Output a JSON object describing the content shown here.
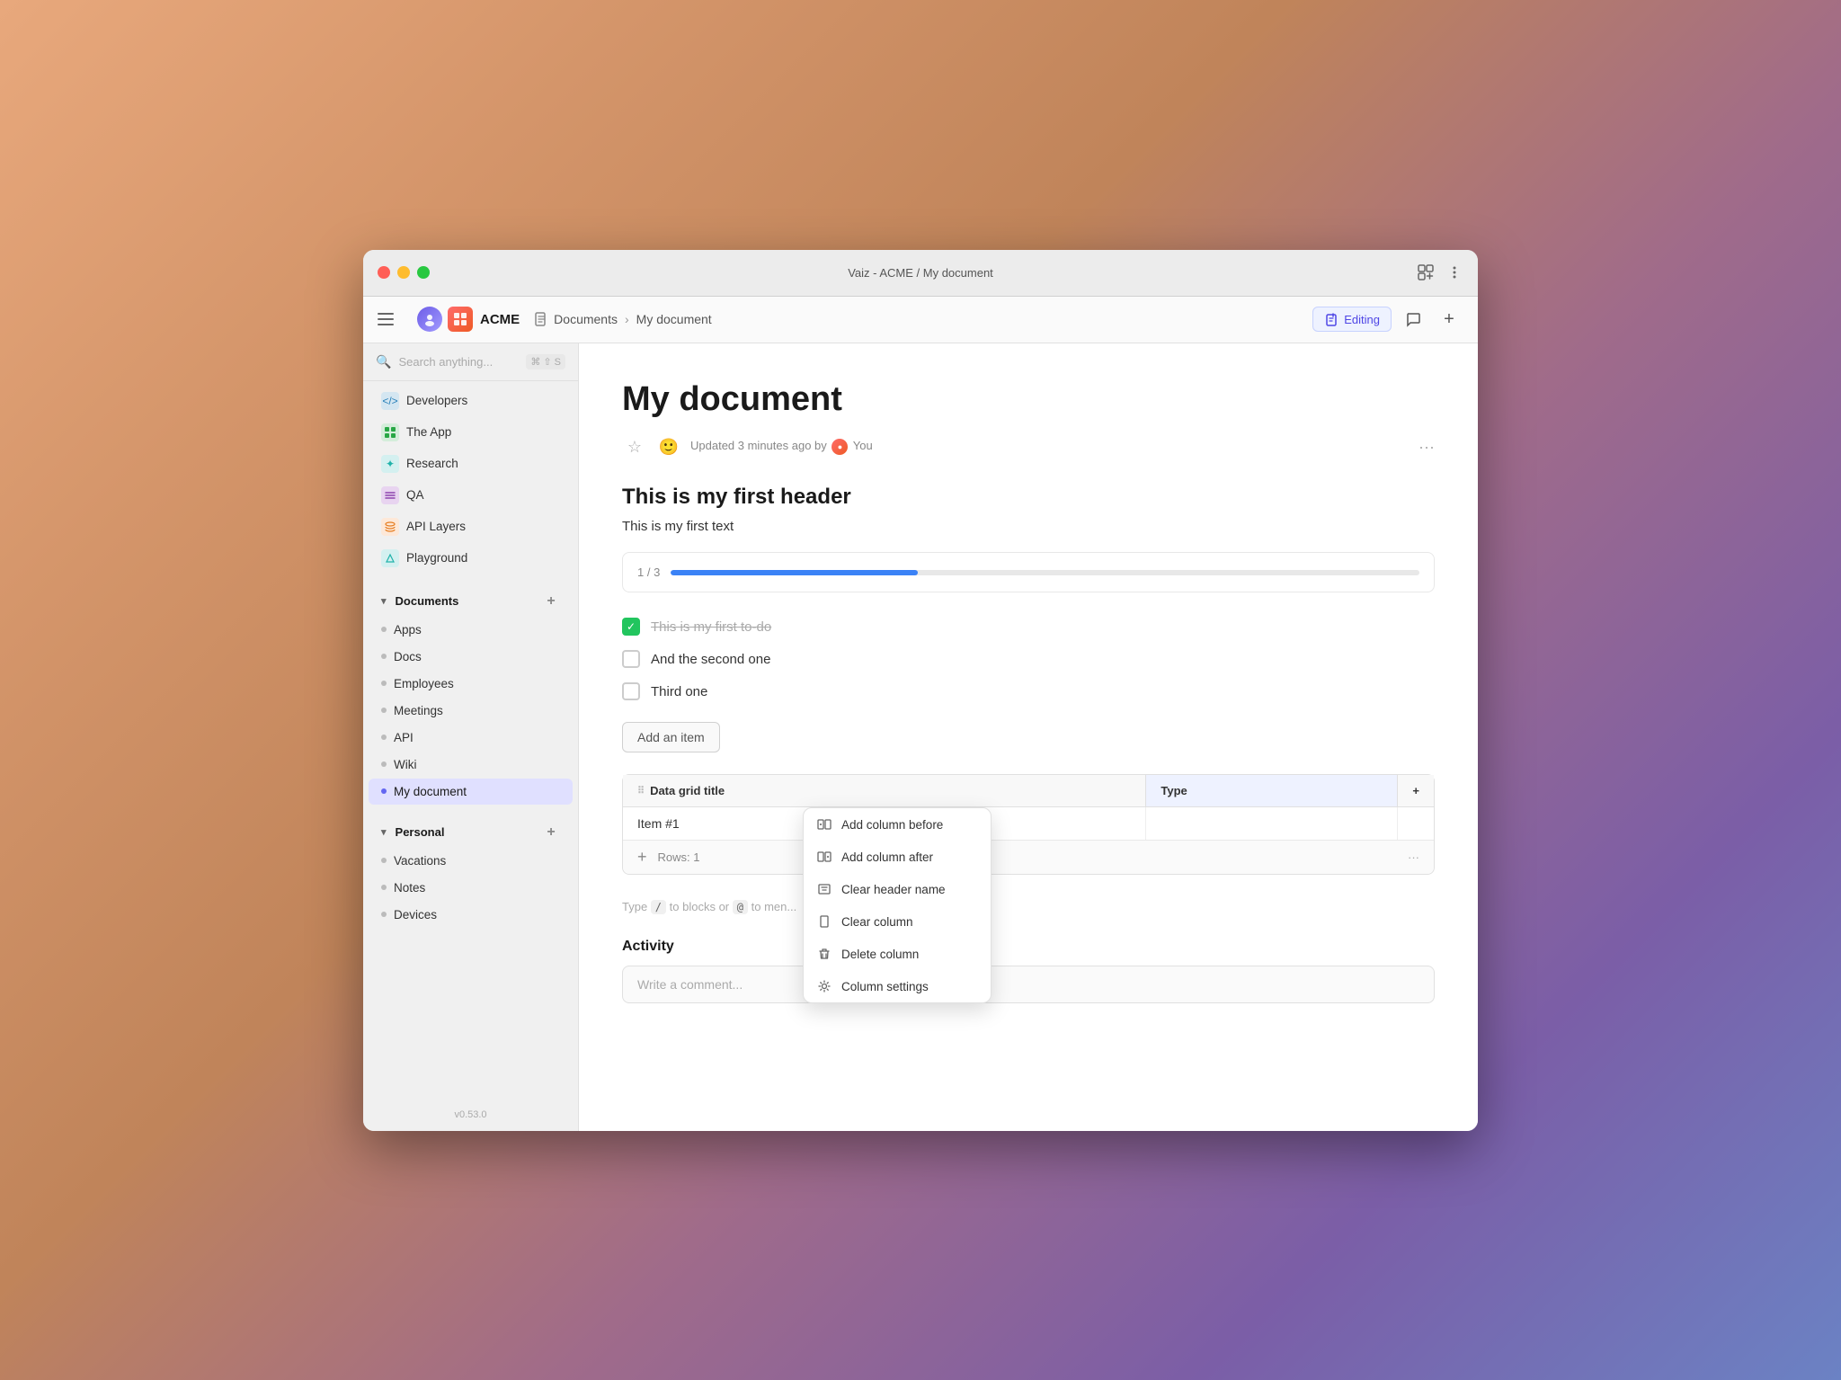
{
  "window": {
    "title": "Vaiz - ACME / My document",
    "traffic_lights": [
      "close",
      "minimize",
      "maximize"
    ]
  },
  "headerbar": {
    "workspace_label": "ACME",
    "breadcrumb_icon": "📄",
    "breadcrumb_section": "Documents",
    "breadcrumb_page": "My document",
    "editing_label": "Editing",
    "plus_label": "+"
  },
  "sidebar": {
    "search_placeholder": "Search anything...",
    "search_shortcut": "⌘ ⇧ S",
    "items_above": [
      {
        "id": "developers",
        "label": "Developers",
        "icon": "</>",
        "icon_class": "icon-blue"
      },
      {
        "id": "the-app",
        "label": "The App",
        "icon": "⊞",
        "icon_class": "icon-green"
      },
      {
        "id": "research",
        "label": "Research",
        "icon": "✦",
        "icon_class": "icon-teal"
      },
      {
        "id": "qa",
        "label": "QA",
        "icon": "☰",
        "icon_class": "icon-purple"
      },
      {
        "id": "api-layers",
        "label": "API Layers",
        "icon": "⊕",
        "icon_class": "icon-orange"
      },
      {
        "id": "playground",
        "label": "Playground",
        "icon": "✦",
        "icon_class": "icon-teal"
      }
    ],
    "documents_section": "Documents",
    "documents_items": [
      {
        "id": "apps",
        "label": "Apps"
      },
      {
        "id": "docs",
        "label": "Docs"
      },
      {
        "id": "employees",
        "label": "Employees"
      },
      {
        "id": "meetings",
        "label": "Meetings"
      },
      {
        "id": "api",
        "label": "API"
      },
      {
        "id": "wiki",
        "label": "Wiki"
      },
      {
        "id": "my-document",
        "label": "My document"
      }
    ],
    "personal_section": "Personal",
    "personal_items": [
      {
        "id": "vacations",
        "label": "Vacations"
      },
      {
        "id": "notes",
        "label": "Notes"
      },
      {
        "id": "devices",
        "label": "Devices"
      }
    ],
    "version": "v0.53.0"
  },
  "content": {
    "doc_title": "My document",
    "meta_updated": "Updated 3 minutes ago by",
    "meta_user": "You",
    "h1": "This is my first header",
    "first_text": "This is my first text",
    "progress_label": "1 / 3",
    "progress_percent": 33,
    "todos": [
      {
        "id": "todo1",
        "text": "This is my first to-do",
        "checked": true
      },
      {
        "id": "todo2",
        "text": "And the second one",
        "checked": false
      },
      {
        "id": "todo3",
        "text": "Third one",
        "checked": false
      }
    ],
    "add_item_label": "Add an item",
    "grid": {
      "col1": "Data grid title",
      "col2": "Type",
      "item1": "Item #1",
      "rows_count": "Rows: 1"
    },
    "context_menu": {
      "items": [
        {
          "id": "add-col-before",
          "label": "Add column before",
          "icon": "⊞"
        },
        {
          "id": "add-col-after",
          "label": "Add column after",
          "icon": "⊞"
        },
        {
          "id": "clear-header",
          "label": "Clear header name",
          "icon": "⊠"
        },
        {
          "id": "clear-col",
          "label": "Clear column",
          "icon": "⬜"
        },
        {
          "id": "delete-col",
          "label": "Delete column",
          "icon": "🗑"
        },
        {
          "id": "col-settings",
          "label": "Column settings",
          "icon": "⚙"
        }
      ]
    },
    "type_hint": "Type",
    "type_slash": "/",
    "type_blocks": "to blocks or",
    "type_at": "@",
    "type_mention": "to men",
    "activity_title": "Activity",
    "comment_placeholder": "Write a comment..."
  }
}
